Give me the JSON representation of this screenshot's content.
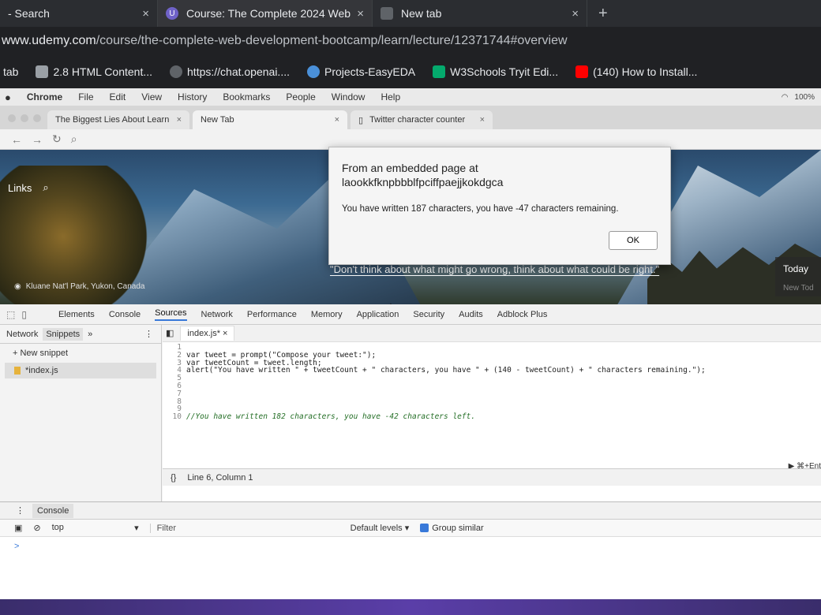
{
  "outer_browser": {
    "tabs": [
      {
        "label": "- Search",
        "close": "×"
      },
      {
        "label": "Course: The Complete 2024 Web",
        "close": "×"
      },
      {
        "label": "New tab",
        "close": "×"
      }
    ],
    "new_tab_symbol": "+",
    "url": {
      "host": "www.udemy.com",
      "path": "/course/the-complete-web-development-bootcamp/learn/lecture/12371744#overview"
    },
    "bookmarks": [
      {
        "label": "tab",
        "color": ""
      },
      {
        "label": "2.8 HTML Content...",
        "color": "#9aa0a6"
      },
      {
        "label": "https://chat.openai....",
        "color": "#5f6368"
      },
      {
        "label": "Projects-EasyEDA",
        "color": "#4a90d9"
      },
      {
        "label": "W3Schools Tryit Edi...",
        "color": "#04aa6d"
      },
      {
        "label": "(140) How to Install...",
        "color": "#ff0000"
      }
    ]
  },
  "mac": {
    "menu": [
      "Chrome",
      "File",
      "Edit",
      "View",
      "History",
      "Bookmarks",
      "People",
      "Window",
      "Help"
    ],
    "battery": "100%",
    "tabs": [
      {
        "label": "The Biggest Lies About Learn",
        "close": "×"
      },
      {
        "label": "New Tab",
        "close": "×"
      },
      {
        "label": "Twitter character counter",
        "close": "×"
      }
    ]
  },
  "newtab": {
    "links_label": "Links",
    "photo_caption": "Kluane Nat'l Park, Yukon, Canada",
    "quote": "\"Don't think about what might go wrong, think about what could be right.\"",
    "today_label": "Today",
    "today_sub": "New Tod"
  },
  "alert": {
    "title_line1": "From an embedded page at",
    "title_line2": "laookkfknpbbblfpciffpaejjkokdgca",
    "message": "You have written 187 characters, you have -47 characters remaining.",
    "ok_label": "OK"
  },
  "devtools": {
    "tabs": [
      "Elements",
      "Console",
      "Sources",
      "Network",
      "Performance",
      "Memory",
      "Application",
      "Security",
      "Audits",
      "Adblock Plus"
    ],
    "active_tab": "Sources",
    "navigator_tabs": [
      "Network",
      "Snippets",
      "»"
    ],
    "new_snippet": "+ New snippet",
    "snippet_file": "*index.js",
    "editor_tab": "index.js*",
    "code_lines": [
      {
        "n": "1",
        "text": ""
      },
      {
        "n": "2",
        "text": "var tweet = prompt(\"Compose your tweet:\");"
      },
      {
        "n": "3",
        "text": "var tweetCount = tweet.length;"
      },
      {
        "n": "4",
        "text": "alert(\"You have written \" + tweetCount + \" characters, you have \" + (140 - tweetCount) + \" characters remaining.\");"
      },
      {
        "n": "5",
        "text": ""
      },
      {
        "n": "6",
        "text": ""
      },
      {
        "n": "7",
        "text": ""
      },
      {
        "n": "8",
        "text": ""
      },
      {
        "n": "9",
        "text": ""
      },
      {
        "n": "10",
        "text": "//You have written 182 characters, you have -42 characters left."
      }
    ],
    "run_hint": "▶ ⌘+Ent",
    "status": "Line 6, Column 1",
    "status_icon": "{}",
    "console_tab": "Console",
    "context": "top",
    "filter_placeholder": "Filter",
    "levels": "Default levels ▾",
    "group_similar": "Group similar",
    "prompt_symbol": ">"
  }
}
